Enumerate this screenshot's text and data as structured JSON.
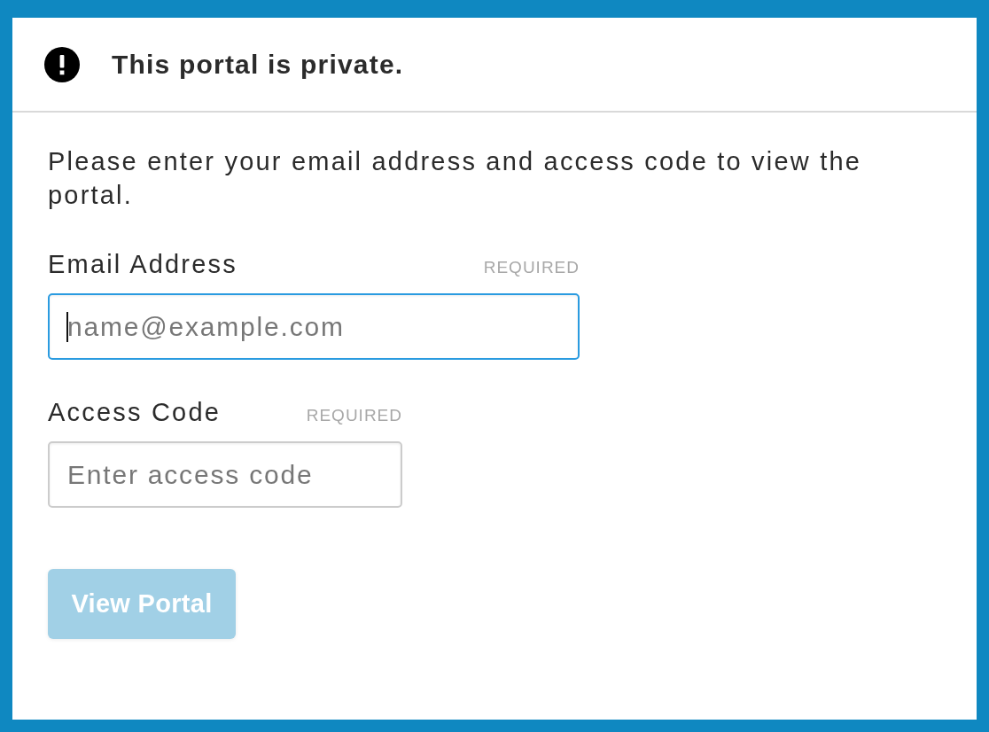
{
  "notice": {
    "title": "This portal is private."
  },
  "intro": "Please enter your email address and access code to view the portal.",
  "fields": [
    {
      "kind": "email",
      "label": "Email Address",
      "badge": "REQUIRED",
      "placeholder": "name@example.com",
      "focused": true
    },
    {
      "kind": "code",
      "label": "Access Code",
      "badge": "REQUIRED",
      "placeholder": "Enter access code",
      "focused": false
    }
  ],
  "submit": {
    "label": "View Portal",
    "disabled": true
  }
}
